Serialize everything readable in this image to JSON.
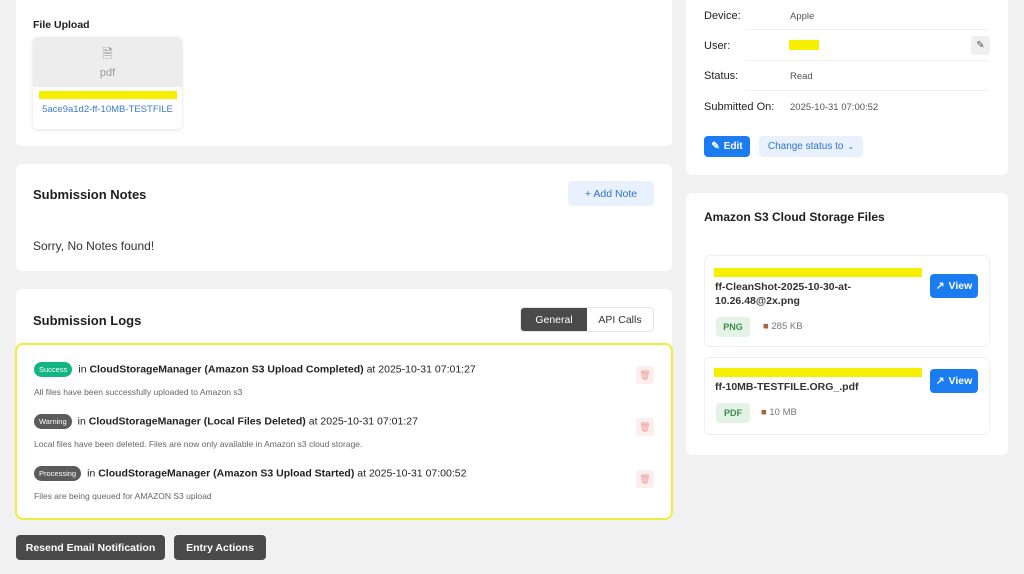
{
  "file_upload": {
    "label": "File Upload",
    "file_type": "pdf",
    "file_name": "5ace9a1d2-ff-10MB-TESTFILE"
  },
  "notes": {
    "title": "Submission Notes",
    "add_label": "+ Add Note",
    "empty_text": "Sorry, No Notes found!"
  },
  "logs": {
    "title": "Submission Logs",
    "tabs": [
      "General",
      "API Calls"
    ],
    "entries": [
      {
        "badge": "Success",
        "badge_color": "#13b582",
        "prefix": "in",
        "source": "CloudStorageManager (Amazon S3 Upload Completed)",
        "at": "at 2025-10-31 07:01:27",
        "desc": "All files have been successfully uploaded to Amazon s3"
      },
      {
        "badge": "Warning",
        "badge_color": "#5b5b5b",
        "prefix": "in",
        "source": "CloudStorageManager (Local Files Deleted)",
        "at": "at 2025-10-31 07:01:27",
        "desc": "Local files have been deleted. Files are now only available in Amazon s3 cloud storage."
      },
      {
        "badge": "Processing",
        "badge_color": "#5b5b5b",
        "prefix": "in",
        "source": "CloudStorageManager (Amazon S3 Upload Started)",
        "at": "at 2025-10-31 07:00:52",
        "desc": "Files are being queued for AMAZON S3 upload"
      }
    ]
  },
  "actions": {
    "resend": "Resend Email Notification",
    "entry_actions": "Entry Actions"
  },
  "info": {
    "device_label": "Device:",
    "device": "Apple",
    "user_label": "User:",
    "status_label": "Status:",
    "status": "Read",
    "submitted_label": "Submitted On:",
    "submitted": "2025-10-31 07:00:52",
    "edit_label": "Edit",
    "change_status_label": "Change status to"
  },
  "s3": {
    "title": "Amazon S3 Cloud Storage Files",
    "view_label": "View",
    "files": [
      {
        "name": "ff-CleanShot-2025-10-30-at-10.26.48@2x.png",
        "type": "PNG",
        "size": "285 KB"
      },
      {
        "name": "ff-10MB-TESTFILE.ORG_.pdf",
        "type": "PDF",
        "size": "10 MB"
      }
    ]
  }
}
